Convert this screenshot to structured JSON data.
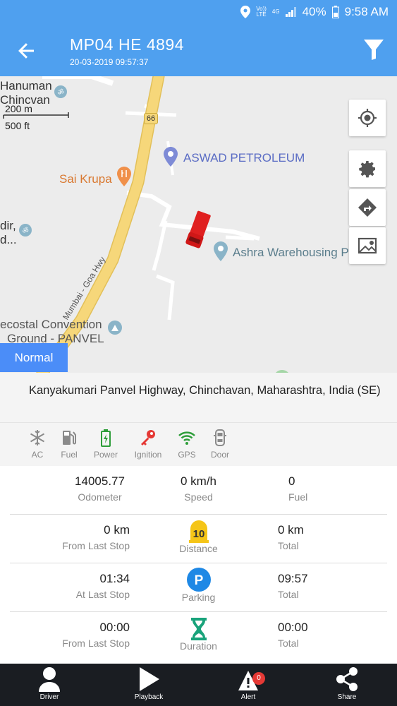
{
  "status_bar": {
    "network_top": "Vo))",
    "network_bottom": "LTE",
    "network_type": "4G",
    "battery": "40%",
    "time": "9:58 AM"
  },
  "header": {
    "title": "MP04 HE 4894",
    "subtitle": "20-03-2019 09:57:37"
  },
  "map": {
    "labels": {
      "hanuman": "Hanuman",
      "chincvan": "Chincvan",
      "scale_m": "200 m",
      "scale_ft": "500 ft",
      "route_number": "66",
      "aswad": "ASWAD PETROLEUM",
      "sai_krupa": "Sai Krupa",
      "mandir_top": "dir,",
      "mandir_bottom": "d...",
      "ashra": "Ashra Warehousing P",
      "highway": "Mumbai - Goa Hwy",
      "ecostal": "ecostal Convention",
      "ground": "Ground - PANVEL"
    },
    "mode_button": "Normal"
  },
  "address": "Kanyakumari  Panvel Highway, Chinchavan, Maharashtra, India (SE)",
  "sensors": [
    {
      "label": "AC",
      "color": "#8a8a8a"
    },
    {
      "label": "Fuel",
      "color": "#8a8a8a"
    },
    {
      "label": "Power",
      "color": "#2e9e3a"
    },
    {
      "label": "Ignition",
      "color": "#e53935"
    },
    {
      "label": "GPS",
      "color": "#2e9e3a"
    },
    {
      "label": "Door",
      "color": "#8a8a8a"
    }
  ],
  "stats": {
    "odometer": {
      "value": "14005.77",
      "label": "Odometer"
    },
    "speed": {
      "value": "0 km/h",
      "label": "Speed"
    },
    "fuel": {
      "value": "0",
      "label": "Fuel"
    },
    "distance_last_stop": {
      "value": "0 km",
      "label": "From Last Stop"
    },
    "distance": {
      "badge": "10",
      "label": "Distance"
    },
    "distance_total": {
      "value": "0 km",
      "label": "Total"
    },
    "parking_last_stop": {
      "value": "01:34",
      "label": "At Last Stop"
    },
    "parking": {
      "badge": "P",
      "label": "Parking"
    },
    "parking_total": {
      "value": "09:57",
      "label": "Total"
    },
    "duration_last_stop": {
      "value": "00:00",
      "label": "From Last Stop"
    },
    "duration": {
      "label": "Duration"
    },
    "duration_total": {
      "value": "00:00",
      "label": "Total"
    }
  },
  "bottom_nav": {
    "driver": "Driver",
    "playback": "Playback",
    "alert": "Alert",
    "alert_count": "0",
    "share": "Share"
  },
  "colors": {
    "primary": "#4fa0ef",
    "normal_button": "#4b8df8",
    "nav_background": "#1a1d22",
    "distance_badge": "#f5c518",
    "parking_badge": "#1e88e5",
    "duration_icon": "#19a37b",
    "vehicle": "#e02020",
    "road": "#f6d77a"
  }
}
